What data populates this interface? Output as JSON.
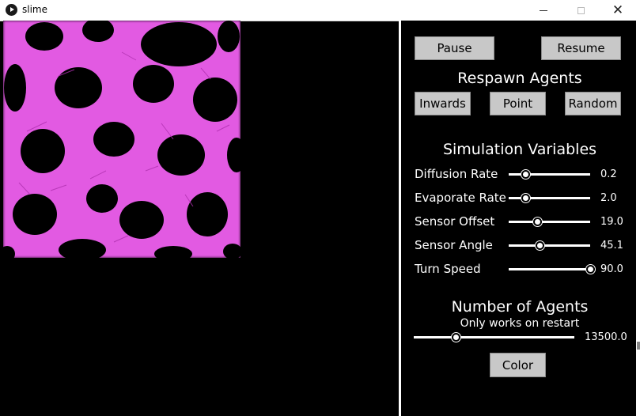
{
  "window": {
    "title": "slime"
  },
  "controls": {
    "pause_label": "Pause",
    "resume_label": "Resume",
    "respawn_heading": "Respawn Agents",
    "inwards_label": "Inwards",
    "point_label": "Point",
    "random_label": "Random",
    "variables_heading": "Simulation Variables",
    "sliders": [
      {
        "label": "Diffusion Rate",
        "value": "0.2",
        "fraction": 0.2
      },
      {
        "label": "Evaporate Rate",
        "value": "2.0",
        "fraction": 0.2
      },
      {
        "label": "Sensor Offset",
        "value": "19.0",
        "fraction": 0.35
      },
      {
        "label": "Sensor Angle",
        "value": "45.1",
        "fraction": 0.38
      },
      {
        "label": "Turn Speed",
        "value": "90.0",
        "fraction": 1.0
      }
    ],
    "agents_heading": "Number of Agents",
    "agents_note": "Only works on restart",
    "agents_value": "13500.0",
    "agents_fraction": 0.26,
    "color_label": "Color"
  },
  "colors": {
    "trail": "#e65ce6",
    "background": "#000000",
    "button": "#c8c8c8"
  }
}
